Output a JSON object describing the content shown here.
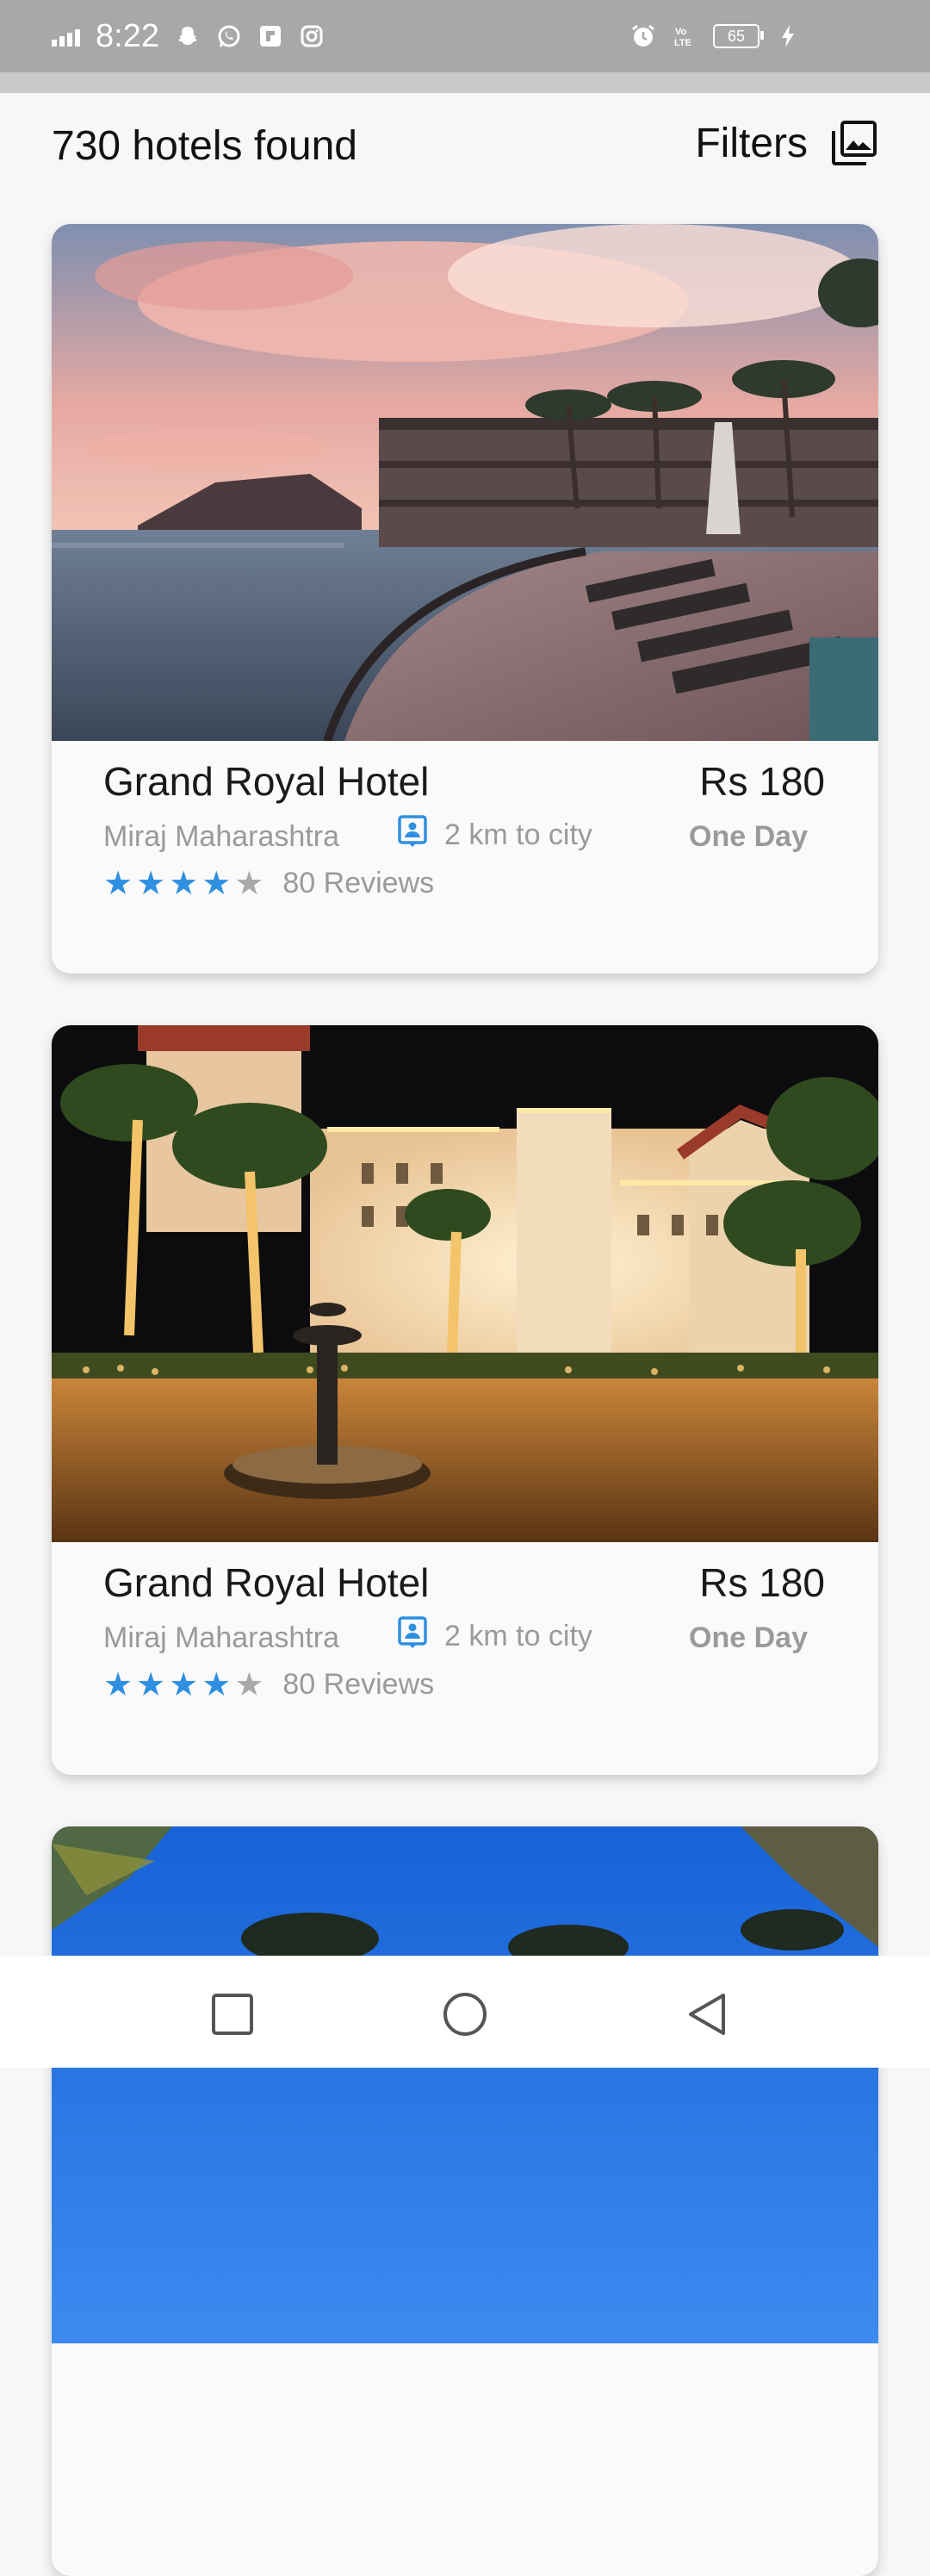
{
  "status_bar": {
    "time": "8:22",
    "battery": "65",
    "icons": [
      "signal-icon",
      "snapchat-icon",
      "whatsapp-icon",
      "flipboard-icon",
      "instagram-icon",
      "alarm-icon",
      "volte-icon",
      "battery-icon",
      "charging-icon"
    ]
  },
  "header": {
    "count_title": "730 hotels found",
    "filters_label": "Filters",
    "filters_icon": "image-gallery-icon"
  },
  "hotels": [
    {
      "name": "Grand Royal Hotel",
      "price": "Rs 180",
      "location": "Miraj Maharashtra",
      "distance": "2 km to city",
      "duration": "One Day",
      "rating": 4,
      "rating_max": 5,
      "reviews": "80 Reviews",
      "image": "seaside-resort-sunset-photo"
    },
    {
      "name": "Grand Royal Hotel",
      "price": "Rs 180",
      "location": "Miraj Maharashtra",
      "distance": "2 km to city",
      "duration": "One Day",
      "rating": 4,
      "rating_max": 5,
      "reviews": "80 Reviews",
      "image": "palace-hotel-night-fountain-photo"
    },
    {
      "image": "palm-trees-blue-sky-photo"
    }
  ],
  "nav_bar": {
    "buttons": [
      "recents-square-icon",
      "home-circle-icon",
      "back-triangle-icon"
    ]
  },
  "colors": {
    "accent_star": "#2f8fe0",
    "status_bar": "#a8a8a8",
    "muted_text": "#9a9a9a"
  }
}
